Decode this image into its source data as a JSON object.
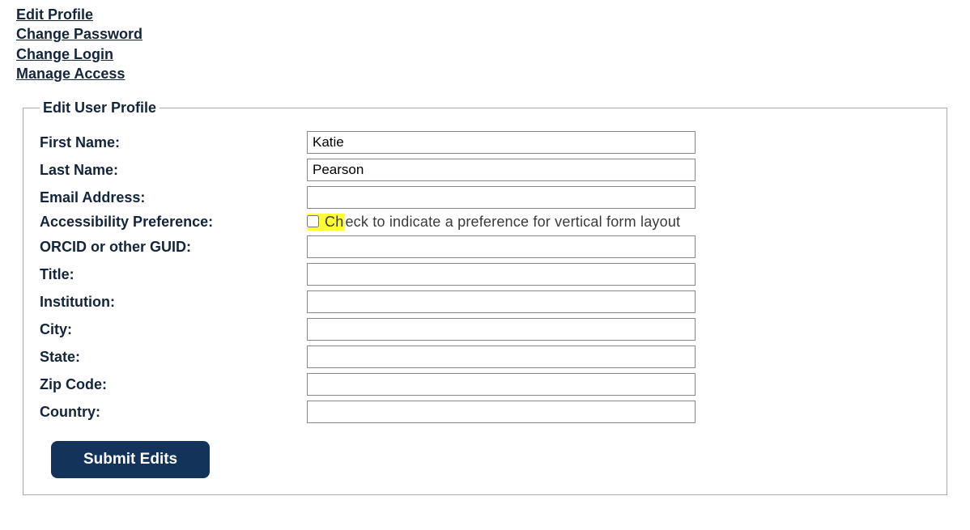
{
  "nav": {
    "edit_profile": "Edit Profile",
    "change_password": "Change Password",
    "change_login": "Change Login",
    "manage_access": "Manage Access"
  },
  "form": {
    "legend": "Edit User Profile",
    "labels": {
      "first_name": "First Name:",
      "last_name": "Last Name:",
      "email": "Email Address:",
      "accessibility": "Accessibility Preference:",
      "orcid": "ORCID or other GUID:",
      "title": "Title:",
      "institution": "Institution:",
      "city": "City:",
      "state": "State:",
      "zip": "Zip Code:",
      "country": "Country:"
    },
    "values": {
      "first_name": "Katie",
      "last_name": "Pearson",
      "email": "",
      "orcid": "",
      "title": "",
      "institution": "",
      "city": "",
      "state": "",
      "zip": "",
      "country": ""
    },
    "accessibility_checkbox_text": "Check to indicate a preference for vertical form layout",
    "accessibility_checked": false,
    "submit_label": "Submit Edits"
  }
}
